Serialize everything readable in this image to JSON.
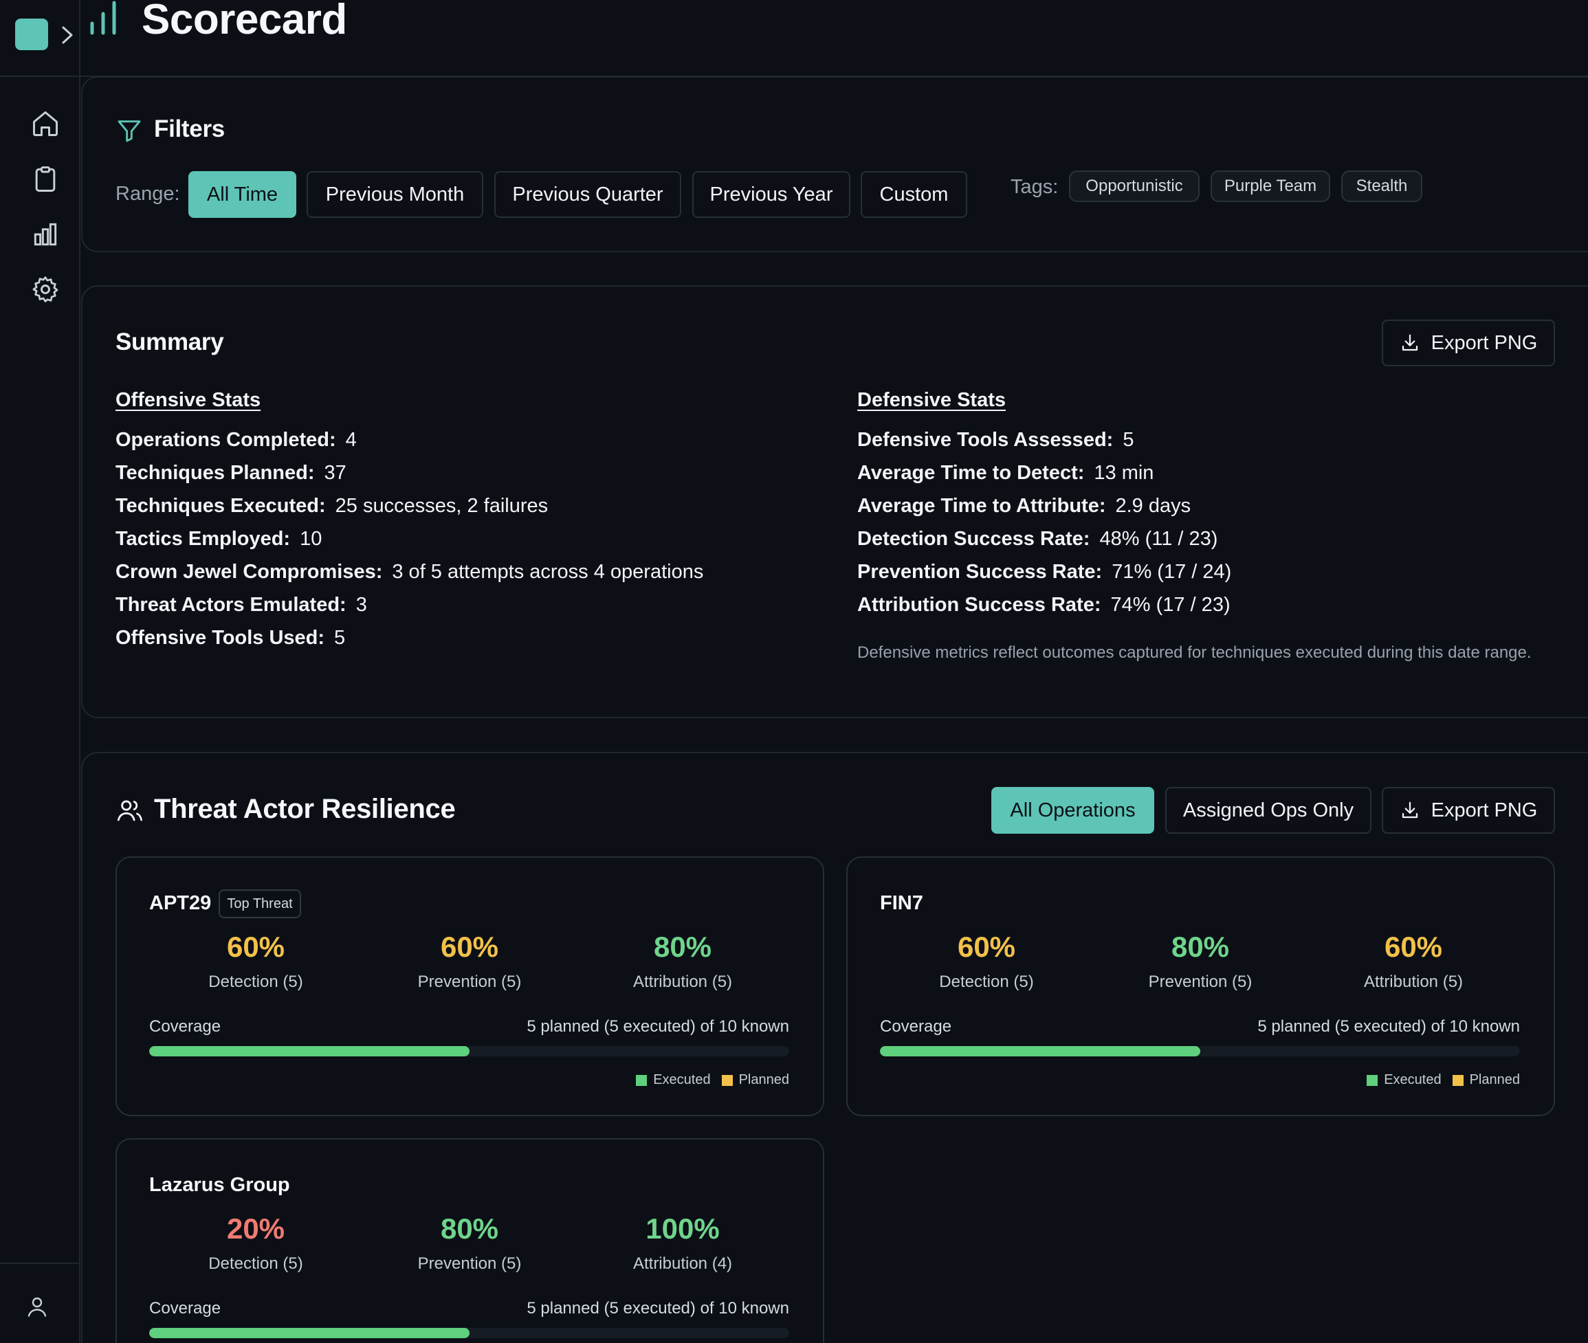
{
  "app": {
    "title": "Scorecard",
    "accent_color": "#5ec4b6",
    "nav": [
      {
        "name": "home",
        "icon": "home-icon"
      },
      {
        "name": "operations",
        "icon": "clipboard-icon"
      },
      {
        "name": "scorecard",
        "icon": "bar-chart-icon"
      },
      {
        "name": "settings",
        "icon": "gear-icon"
      }
    ],
    "user_icon": "user-icon"
  },
  "filters": {
    "title": "Filters",
    "range_label": "Range:",
    "ranges": [
      "All Time",
      "Previous Month",
      "Previous Quarter",
      "Previous Year",
      "Custom"
    ],
    "selected_range": "All Time",
    "tags_label": "Tags:",
    "tags": [
      "Opportunistic",
      "Purple Team",
      "Stealth"
    ]
  },
  "summary": {
    "title": "Summary",
    "export_label": "Export PNG",
    "offensive": {
      "heading": "Offensive Stats",
      "rows": [
        {
          "label": "Operations Completed:",
          "value": "4"
        },
        {
          "label": "Techniques Planned:",
          "value": "37"
        },
        {
          "label": "Techniques Executed:",
          "value": "25 successes, 2 failures"
        },
        {
          "label": "Tactics Employed:",
          "value": "10"
        },
        {
          "label": "Crown Jewel Compromises:",
          "value": "3 of 5 attempts across 4 operations"
        },
        {
          "label": "Threat Actors Emulated:",
          "value": "3"
        },
        {
          "label": "Offensive Tools Used:",
          "value": "5"
        }
      ]
    },
    "defensive": {
      "heading": "Defensive Stats",
      "rows": [
        {
          "label": "Defensive Tools Assessed:",
          "value": "5"
        },
        {
          "label": "Average Time to Detect:",
          "value": "13 min"
        },
        {
          "label": "Average Time to Attribute:",
          "value": "2.9 days"
        },
        {
          "label": "Detection Success Rate:",
          "value": "48% (11 / 23)"
        },
        {
          "label": "Prevention Success Rate:",
          "value": "71% (17 / 24)"
        },
        {
          "label": "Attribution Success Rate:",
          "value": "74% (17 / 23)"
        }
      ],
      "note": "Defensive metrics reflect outcomes captured for techniques executed during this date range."
    }
  },
  "resilience": {
    "title": "Threat Actor Resilience",
    "toggle": [
      "All Operations",
      "Assigned Ops Only"
    ],
    "selected_toggle": "All Operations",
    "export_label": "Export PNG",
    "coverage_label": "Coverage",
    "legend": {
      "executed": "Executed",
      "planned": "Planned",
      "executed_color": "#5fd07d",
      "planned_color": "#f3c14a"
    },
    "actors": [
      {
        "name": "APT29",
        "badge": "Top Threat",
        "metrics": [
          {
            "value": "60%",
            "label": "Detection (5)",
            "color": "yellow"
          },
          {
            "value": "60%",
            "label": "Prevention (5)",
            "color": "yellow"
          },
          {
            "value": "80%",
            "label": "Attribution (5)",
            "color": "green"
          }
        ],
        "coverage_text": "5 planned (5 executed) of 10 known",
        "executed_fraction": 0.5
      },
      {
        "name": "FIN7",
        "badge": "",
        "metrics": [
          {
            "value": "60%",
            "label": "Detection (5)",
            "color": "yellow"
          },
          {
            "value": "80%",
            "label": "Prevention (5)",
            "color": "green"
          },
          {
            "value": "60%",
            "label": "Attribution (5)",
            "color": "yellow"
          }
        ],
        "coverage_text": "5 planned (5 executed) of 10 known",
        "executed_fraction": 0.5
      },
      {
        "name": "Lazarus Group",
        "badge": "",
        "metrics": [
          {
            "value": "20%",
            "label": "Detection (5)",
            "color": "red"
          },
          {
            "value": "80%",
            "label": "Prevention (5)",
            "color": "green"
          },
          {
            "value": "100%",
            "label": "Attribution (4)",
            "color": "green"
          }
        ],
        "coverage_text": "5 planned (5 executed) of 10 known",
        "executed_fraction": 0.5
      }
    ]
  }
}
